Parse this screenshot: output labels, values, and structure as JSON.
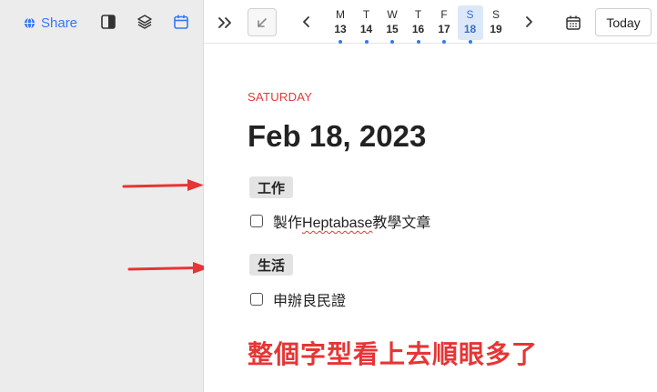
{
  "sidebar": {
    "share_label": "Share",
    "icons": [
      "globe-icon",
      "sidebar-toggle-icon",
      "layers-icon",
      "calendar-icon"
    ]
  },
  "topbar": {
    "week": [
      {
        "letter": "M",
        "num": "13",
        "selected": false
      },
      {
        "letter": "T",
        "num": "14",
        "selected": false
      },
      {
        "letter": "W",
        "num": "15",
        "selected": false
      },
      {
        "letter": "T",
        "num": "16",
        "selected": false
      },
      {
        "letter": "F",
        "num": "17",
        "selected": false
      },
      {
        "letter": "S",
        "num": "18",
        "selected": true
      },
      {
        "letter": "S",
        "num": "19",
        "selected": false
      }
    ],
    "today_label": "Today"
  },
  "journal": {
    "weekday": "SATURDAY",
    "date": "Feb 18, 2023",
    "sections": [
      {
        "tag": "工作",
        "todos": [
          {
            "prefix": "製作",
            "highlight": "Heptabase",
            "suffix": "教學文章",
            "checked": false
          }
        ]
      },
      {
        "tag": "生活",
        "todos": [
          {
            "prefix": "申辦良民證",
            "highlight": "",
            "suffix": "",
            "checked": false
          }
        ]
      }
    ]
  },
  "annotation": {
    "text": "整個字型看上去順眼多了",
    "color": "#e63535"
  },
  "colors": {
    "accent": "#3478f6",
    "weekday_red": "#e0393b",
    "arrow_red": "#e63535",
    "sidebar_bg": "#ececec",
    "selected_day_bg": "#dce8f8"
  }
}
